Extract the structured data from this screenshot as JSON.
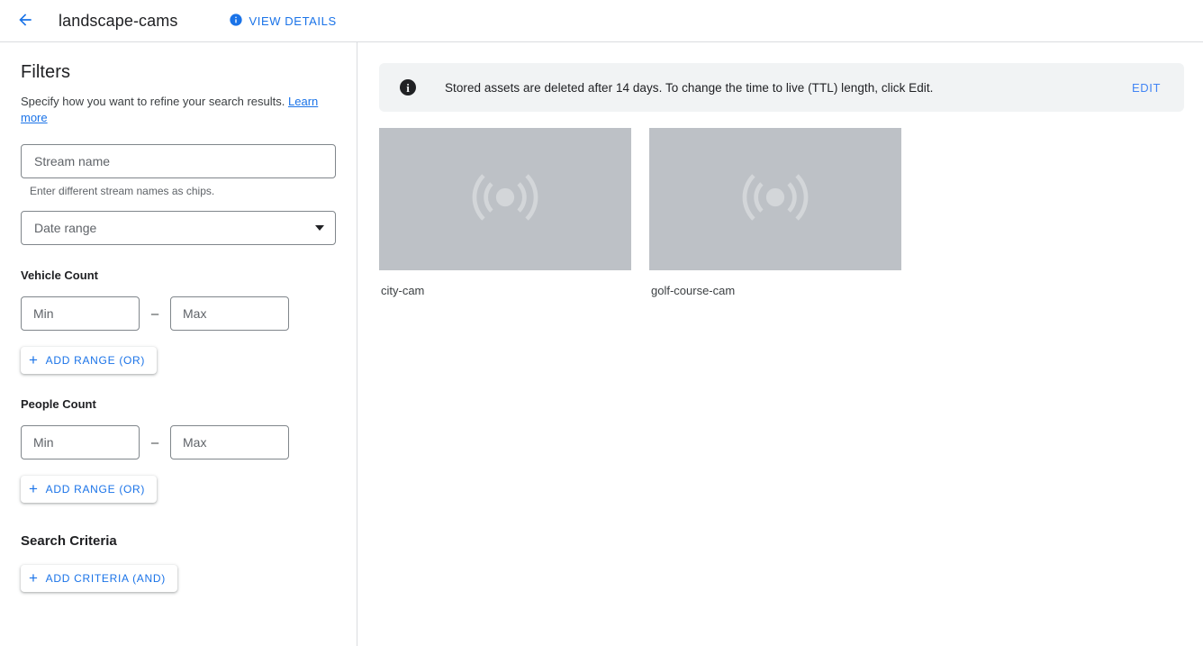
{
  "header": {
    "back_icon": "arrow-back-icon",
    "title": "landscape-cams",
    "view_details_label": "VIEW DETAILS",
    "view_details_icon": "info-icon"
  },
  "filters": {
    "heading": "Filters",
    "description": "Specify how you want to refine your search results.",
    "learn_more_label": "Learn more",
    "stream_name": {
      "placeholder": "Stream name",
      "value": "",
      "hint": "Enter different stream names as chips."
    },
    "date_range": {
      "label": "Date range",
      "value": "",
      "caret_icon": "chevron-down-icon"
    },
    "vehicle_count": {
      "label": "Vehicle Count",
      "min_placeholder": "Min",
      "min_value": "",
      "max_placeholder": "Max",
      "max_value": "",
      "separator": "–",
      "add_range_label": "ADD RANGE (OR)",
      "add_icon": "plus-icon"
    },
    "people_count": {
      "label": "People Count",
      "min_placeholder": "Min",
      "min_value": "",
      "max_placeholder": "Max",
      "max_value": "",
      "separator": "–",
      "add_range_label": "ADD RANGE (OR)",
      "add_icon": "plus-icon"
    },
    "search_criteria": {
      "label": "Search Criteria",
      "add_criteria_label": "ADD CRITERIA (AND)",
      "add_icon": "plus-icon"
    }
  },
  "banner": {
    "icon": "info-icon",
    "message": "Stored assets are deleted after 14 days. To change the time to live (TTL) length, click Edit.",
    "action_label": "EDIT"
  },
  "results": {
    "cards": [
      {
        "name": "city-cam",
        "thumbnail_icon": "stream-signal-icon"
      },
      {
        "name": "golf-course-cam",
        "thumbnail_icon": "stream-signal-icon"
      }
    ]
  },
  "colors": {
    "accent_blue": "#1a73e8",
    "banner_bg": "#f1f3f4",
    "thumbnail_bg": "#bdc1c6",
    "border": "#dadce0"
  }
}
